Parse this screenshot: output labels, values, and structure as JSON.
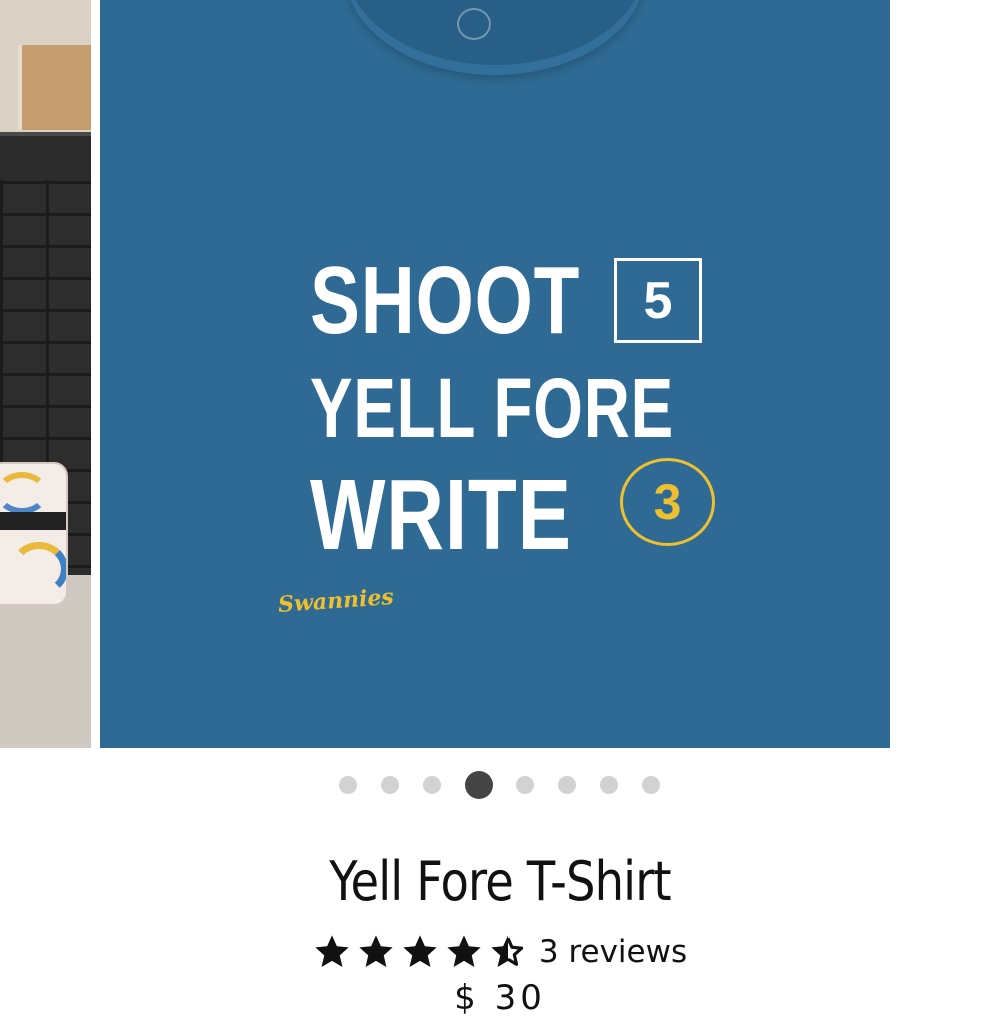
{
  "carousel": {
    "slide_count": 8,
    "active_index": 3,
    "shirt_print": {
      "line1": "SHOOT",
      "box_score": "5",
      "line2": "YELL FORE",
      "line3": "WRITE",
      "circle_score": "3",
      "brand": "Swannies"
    }
  },
  "product": {
    "title": "Yell Fore T-Shirt",
    "rating": 4.5,
    "rating_max": 5,
    "reviews_label": "3 reviews",
    "price": "$ 30"
  },
  "colors": {
    "shirt_blue": "#2e6a93",
    "print_white": "#ffffff",
    "accent_gold": "#eebf2f",
    "dot_active": "#444444",
    "dot_inactive": "#d2d2d2",
    "star": "#111111"
  },
  "icons": [
    "star-icon",
    "half-star-icon"
  ]
}
